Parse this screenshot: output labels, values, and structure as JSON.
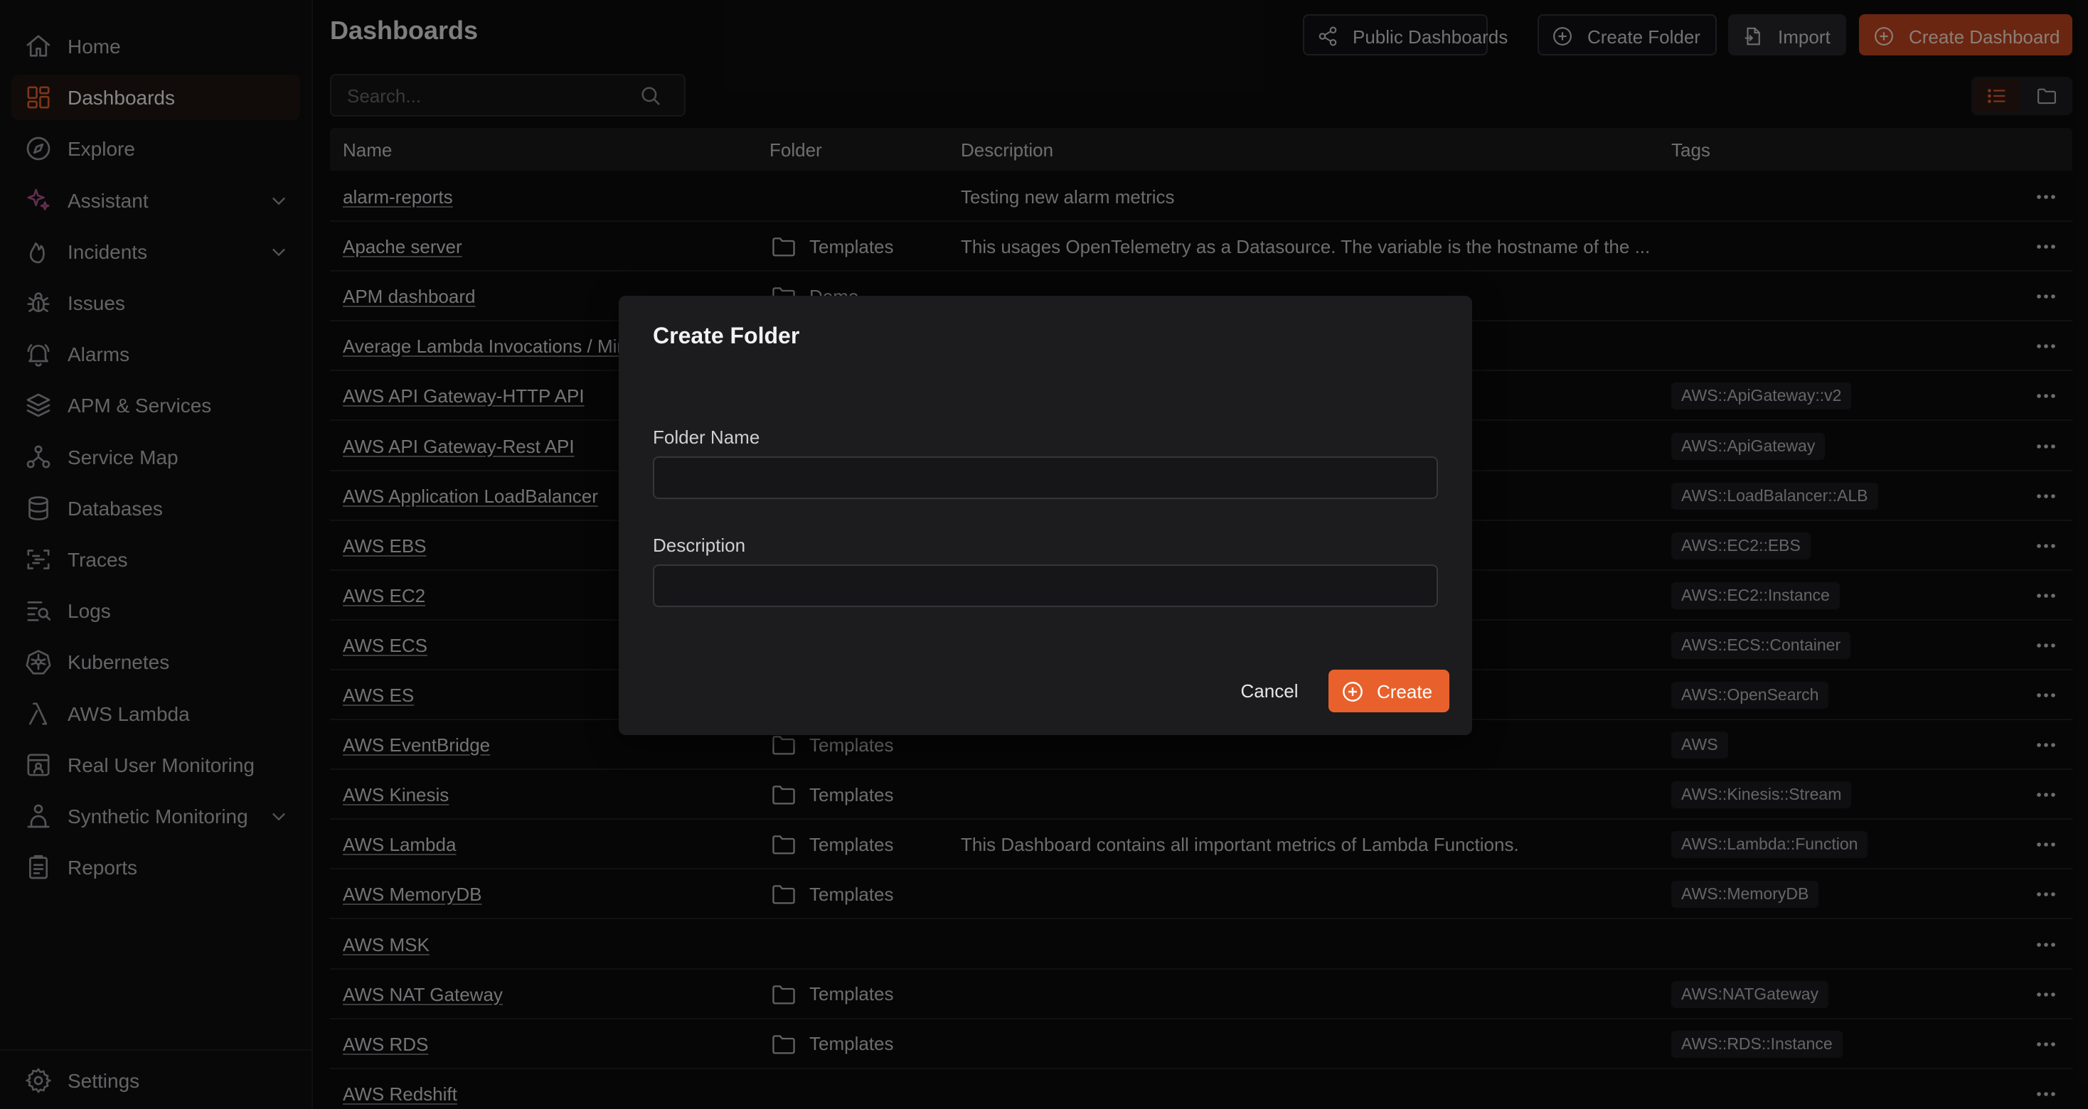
{
  "sidebar": {
    "items": [
      {
        "label": "Home",
        "icon": "home-icon",
        "active": false,
        "expandable": false
      },
      {
        "label": "Dashboards",
        "icon": "dashboard-icon",
        "active": true,
        "expandable": false
      },
      {
        "label": "Explore",
        "icon": "compass-icon",
        "active": false,
        "expandable": false
      },
      {
        "label": "Assistant",
        "icon": "sparkles-icon",
        "active": false,
        "expandable": true
      },
      {
        "label": "Incidents",
        "icon": "flame-icon",
        "active": false,
        "expandable": true
      },
      {
        "label": "Issues",
        "icon": "bug-icon",
        "active": false,
        "expandable": false
      },
      {
        "label": "Alarms",
        "icon": "bell-icon",
        "active": false,
        "expandable": false
      },
      {
        "label": "APM & Services",
        "icon": "layers-icon",
        "active": false,
        "expandable": false
      },
      {
        "label": "Service Map",
        "icon": "network-icon",
        "active": false,
        "expandable": false
      },
      {
        "label": "Databases",
        "icon": "database-icon",
        "active": false,
        "expandable": false
      },
      {
        "label": "Traces",
        "icon": "traces-icon",
        "active": false,
        "expandable": false
      },
      {
        "label": "Logs",
        "icon": "logs-search-icon",
        "active": false,
        "expandable": false
      },
      {
        "label": "Kubernetes",
        "icon": "kubernetes-icon",
        "active": false,
        "expandable": false
      },
      {
        "label": "AWS Lambda",
        "icon": "lambda-icon",
        "active": false,
        "expandable": false
      },
      {
        "label": "Real User Monitoring",
        "icon": "browser-user-icon",
        "active": false,
        "expandable": false
      },
      {
        "label": "Synthetic Monitoring",
        "icon": "synthetic-icon",
        "active": false,
        "expandable": true
      },
      {
        "label": "Reports",
        "icon": "report-icon",
        "active": false,
        "expandable": false
      }
    ],
    "settings_label": "Settings"
  },
  "header": {
    "title": "Dashboards",
    "public_dashboards_label": "Public Dashboards",
    "create_folder_label": "Create Folder",
    "import_label": "Import",
    "create_dashboard_label": "Create Dashboard"
  },
  "search": {
    "placeholder": "Search..."
  },
  "colors": {
    "accent": "#e8612c",
    "accent_dark": "#c2451f",
    "background": "#0c0c0d"
  },
  "table": {
    "columns": [
      "Name",
      "Folder",
      "Description",
      "Tags"
    ],
    "rows": [
      {
        "name": "alarm-reports",
        "folder": "",
        "description": "Testing new alarm metrics",
        "tag": ""
      },
      {
        "name": "Apache server",
        "folder": "Templates",
        "description": "This usages OpenTelemetry as a Datasource. The variable is the hostname of the ...",
        "tag": ""
      },
      {
        "name": "APM dashboard",
        "folder": "Demo",
        "description": "",
        "tag": ""
      },
      {
        "name": "Average Lambda Invocations / Minute",
        "folder": "",
        "description": "",
        "tag": ""
      },
      {
        "name": "AWS API Gateway-HTTP API",
        "folder": "",
        "description": "",
        "tag": "AWS::ApiGateway::v2"
      },
      {
        "name": "AWS API Gateway-Rest API",
        "folder": "",
        "description": "",
        "tag": "AWS::ApiGateway"
      },
      {
        "name": "AWS Application LoadBalancer",
        "folder": "",
        "description": "",
        "tag": "AWS::LoadBalancer::ALB"
      },
      {
        "name": "AWS EBS",
        "folder": "",
        "description": "",
        "tag": "AWS::EC2::EBS"
      },
      {
        "name": "AWS EC2",
        "folder": "",
        "description": "",
        "tag": "AWS::EC2::Instance"
      },
      {
        "name": "AWS ECS",
        "folder": "",
        "description": "",
        "tag": "AWS::ECS::Container"
      },
      {
        "name": "AWS ES",
        "folder": "",
        "description": "",
        "tag": "AWS::OpenSearch"
      },
      {
        "name": "AWS EventBridge",
        "folder": "Templates",
        "description": "",
        "tag": "AWS"
      },
      {
        "name": "AWS Kinesis",
        "folder": "Templates",
        "description": "",
        "tag": "AWS::Kinesis::Stream"
      },
      {
        "name": "AWS Lambda",
        "folder": "Templates",
        "description": "This Dashboard contains all important metrics of Lambda Functions.",
        "tag": "AWS::Lambda::Function"
      },
      {
        "name": "AWS MemoryDB",
        "folder": "Templates",
        "description": "",
        "tag": "AWS::MemoryDB"
      },
      {
        "name": "AWS MSK",
        "folder": "",
        "description": "",
        "tag": ""
      },
      {
        "name": "AWS NAT Gateway",
        "folder": "Templates",
        "description": "",
        "tag": "AWS:NATGateway"
      },
      {
        "name": "AWS RDS",
        "folder": "Templates",
        "description": "",
        "tag": "AWS::RDS::Instance"
      },
      {
        "name": "AWS Redshift",
        "folder": "",
        "description": "",
        "tag": ""
      }
    ]
  },
  "modal": {
    "title": "Create Folder",
    "folder_name_label": "Folder Name",
    "folder_name_value": "",
    "description_label": "Description",
    "description_value": "",
    "cancel_label": "Cancel",
    "create_label": "Create"
  }
}
